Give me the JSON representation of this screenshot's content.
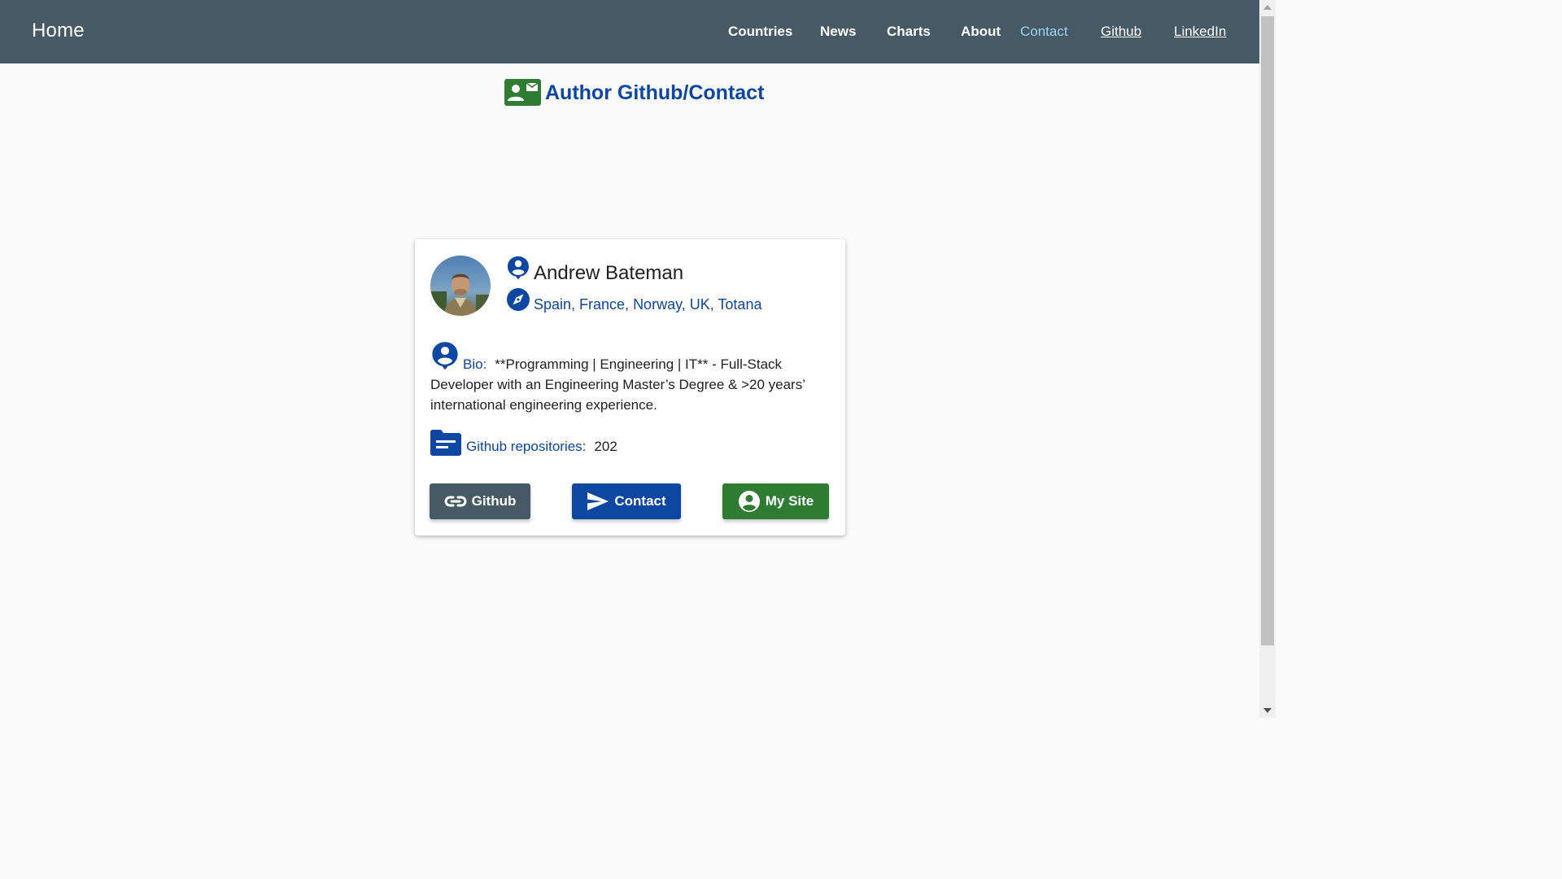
{
  "nav": {
    "brand": "Home",
    "links": [
      {
        "label": "Countries"
      },
      {
        "label": "News"
      },
      {
        "label": "Charts"
      },
      {
        "label": "About"
      },
      {
        "label": "Contact"
      },
      {
        "label": "Github"
      },
      {
        "label": "LinkedIn"
      }
    ]
  },
  "page": {
    "title": "Author Github/Contact"
  },
  "profile": {
    "name": "Andrew Bateman",
    "location": "Spain, France, Norway, UK, Totana",
    "bio_label": "Bio:",
    "bio_text": "**Programming | Engineering | IT** - Full-Stack Developer with an Engineering Master’s Degree & >20 years’ international engineering experience.",
    "repos_label": "Github repositories:",
    "repos_count": "202"
  },
  "buttons": {
    "github": "Github",
    "contact": "Contact",
    "site": "My Site"
  },
  "colors": {
    "navbar": "#455a64",
    "active_link": "#9ed3f0",
    "primary_text": "#0d47a1",
    "github_button": "#455a64",
    "contact_button": "#0d47a1",
    "site_button": "#2e7d32",
    "title_icon": "#2e7d32"
  },
  "icons": {
    "title": "contact-mail-icon",
    "name": "person-pin-icon",
    "location": "explore-compass-icon",
    "bio": "person-pin-icon",
    "repos": "folder-icon",
    "github_button": "link-icon",
    "contact_button": "send-icon",
    "site_button": "account-circle-icon"
  }
}
